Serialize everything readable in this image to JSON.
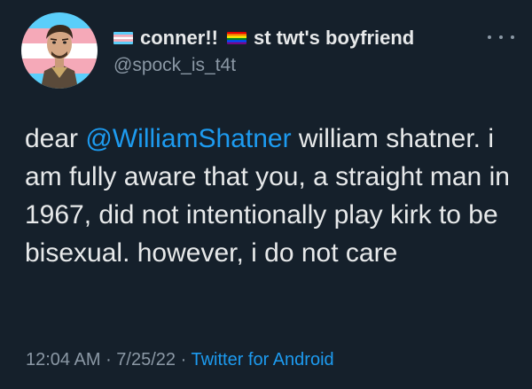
{
  "user": {
    "display_name": "conner!!",
    "display_name_extra": "st twt's boyfriend",
    "handle": "@spock_is_t4t",
    "avatar": "cartoon-character-portrait-avatar",
    "flags": [
      "transgender-flag",
      "rainbow-flag"
    ]
  },
  "tweet": {
    "text_before": "dear ",
    "mention": "@WilliamShatner",
    "text_after": " william shatner. i am fully aware that you, a straight man in 1967, did not intentionally play kirk to be bisexual. however, i do not care"
  },
  "meta": {
    "time": "12:04 AM",
    "sep1": " · ",
    "date": "7/25/22",
    "sep2": " · ",
    "source": "Twitter for Android"
  },
  "colors": {
    "background": "#15202b",
    "text": "#e7e9ea",
    "secondary": "#8b98a5",
    "accent": "#1d9bf0"
  },
  "icons": {
    "more": "more-options-icon"
  }
}
